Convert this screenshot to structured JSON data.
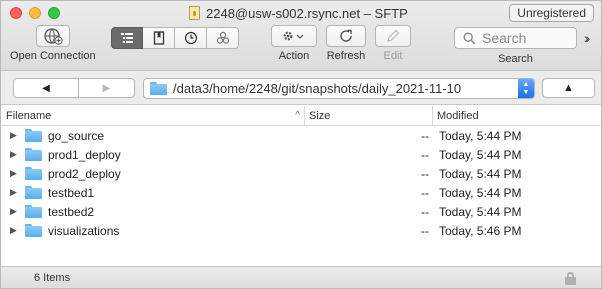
{
  "window": {
    "title": "2248@usw-s002.rsync.net – SFTP",
    "unregistered_label": "Unregistered"
  },
  "toolbar": {
    "open_connection_label": "Open Connection",
    "action_label": "Action",
    "refresh_label": "Refresh",
    "edit_label": "Edit",
    "search_placeholder": "Search",
    "search_label": "Search",
    "more_glyph": "››"
  },
  "pathbar": {
    "back_glyph": "◀",
    "forward_glyph": "▶",
    "current_path": "/data3/home/2248/git/snapshots/daily_2021-11-10",
    "up_glyph": "▲"
  },
  "table": {
    "columns": {
      "name": "Filename",
      "size": "Size",
      "modified": "Modified"
    },
    "rows": [
      {
        "name": "go_source",
        "size": "--",
        "modified": "Today, 5:44 PM"
      },
      {
        "name": "prod1_deploy",
        "size": "--",
        "modified": "Today, 5:44 PM"
      },
      {
        "name": "prod2_deploy",
        "size": "--",
        "modified": "Today, 5:44 PM"
      },
      {
        "name": "testbed1",
        "size": "--",
        "modified": "Today, 5:44 PM"
      },
      {
        "name": "testbed2",
        "size": "--",
        "modified": "Today, 5:44 PM"
      },
      {
        "name": "visualizations",
        "size": "--",
        "modified": "Today, 5:46 PM"
      }
    ]
  },
  "status": {
    "item_count": "6 Items"
  }
}
